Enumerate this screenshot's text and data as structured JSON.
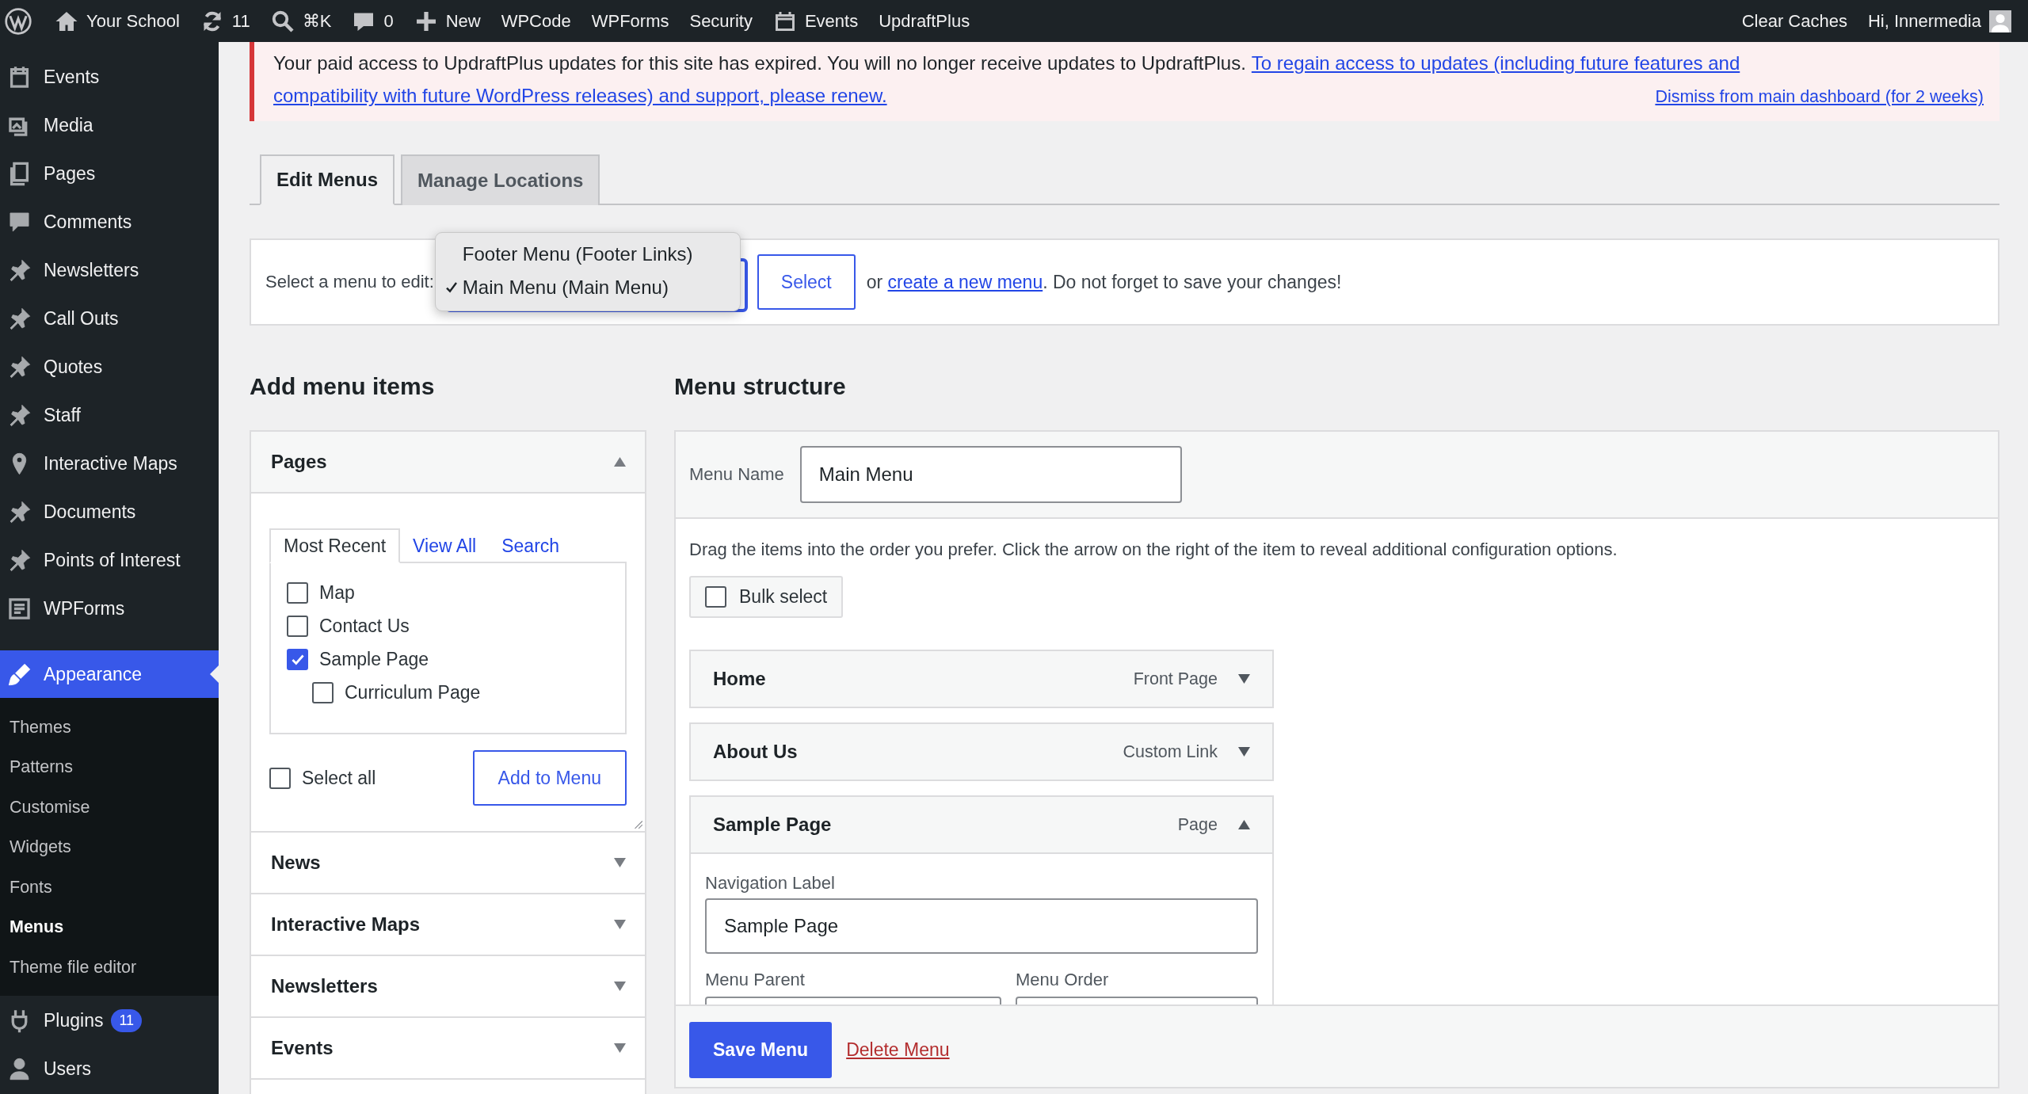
{
  "admin_bar": {
    "left": [
      {
        "kind": "wordpress"
      },
      {
        "kind": "home",
        "label": "Your School"
      },
      {
        "kind": "updates",
        "label": "11"
      },
      {
        "kind": "search",
        "label": "⌘K"
      },
      {
        "kind": "comments",
        "label": "0"
      },
      {
        "kind": "new",
        "label": "New"
      },
      {
        "kind": "text",
        "label": "WPCode"
      },
      {
        "kind": "text",
        "label": "WPForms"
      },
      {
        "kind": "text",
        "label": "Security"
      },
      {
        "kind": "calendar",
        "label": "Events"
      },
      {
        "kind": "text",
        "label": "UpdraftPlus"
      }
    ],
    "right": [
      {
        "kind": "text",
        "label": "Clear Caches"
      },
      {
        "kind": "account",
        "label": "Hi, Innermedia"
      }
    ]
  },
  "sidebar": {
    "items": [
      {
        "label": "Events",
        "kind": "calendar",
        "selected": false
      },
      {
        "label": "Media",
        "kind": "media",
        "selected": false
      },
      {
        "label": "Pages",
        "kind": "pages",
        "selected": false
      },
      {
        "label": "Comments",
        "kind": "comments",
        "selected": false
      },
      {
        "label": "Newsletters",
        "kind": "pin",
        "selected": false
      },
      {
        "label": "Call Outs",
        "kind": "pin",
        "selected": false
      },
      {
        "label": "Quotes",
        "kind": "pin",
        "selected": false
      },
      {
        "label": "Staff",
        "kind": "pin",
        "selected": false
      },
      {
        "label": "Interactive Maps",
        "kind": "location",
        "selected": false
      },
      {
        "label": "Documents",
        "kind": "pin",
        "selected": false
      },
      {
        "label": "Points of Interest",
        "kind": "pin",
        "selected": false
      },
      {
        "label": "WPForms",
        "kind": "forms",
        "selected": false
      },
      {
        "label": "Appearance",
        "kind": "brush",
        "selected": true,
        "children": [
          {
            "label": "Themes",
            "selected": false
          },
          {
            "label": "Patterns",
            "selected": false
          },
          {
            "label": "Customise",
            "selected": false
          },
          {
            "label": "Widgets",
            "selected": false
          },
          {
            "label": "Fonts",
            "selected": false
          },
          {
            "label": "Menus",
            "selected": true
          },
          {
            "label": "Theme file editor",
            "selected": false
          }
        ]
      },
      {
        "label": "Plugins",
        "kind": "plugin",
        "selected": false,
        "badge": "11"
      },
      {
        "label": "Users",
        "kind": "user",
        "selected": false
      }
    ]
  },
  "notice": {
    "message": "Your paid access to UpdraftPlus updates for this site has expired. You will no longer receive updates to UpdraftPlus.",
    "link_lines": [
      "To regain access to updates (including future features and",
      "compatibility with future WordPress releases) and support, please renew."
    ],
    "dismiss": "Dismiss from main dashboard (for 2 weeks)"
  },
  "tabs": [
    {
      "label": "Edit Menus",
      "selected": true
    },
    {
      "label": "Manage Locations",
      "selected": false
    }
  ],
  "menu_select": {
    "label": "Select a menu to edit:",
    "options": [
      {
        "label": "Footer Menu (Footer Links)",
        "selected": false
      },
      {
        "label": "Main Menu (Main Menu)",
        "selected": true
      }
    ],
    "button": "Select",
    "note_before": "or",
    "link": "create a new menu",
    "note_after": ". Do not forget to save your changes!"
  },
  "add_menu_items": {
    "heading": "Add menu items",
    "sections": [
      {
        "title": "Pages",
        "expanded": true,
        "tabs": [
          {
            "label": "Most Recent",
            "selected": true
          },
          {
            "label": "View All",
            "selected": false
          },
          {
            "label": "Search",
            "selected": false
          }
        ],
        "items": [
          {
            "label": "Map",
            "checked": false
          },
          {
            "label": "Contact Us",
            "checked": false
          },
          {
            "label": "Sample Page",
            "checked": true,
            "children": [
              {
                "label": "Curriculum Page",
                "checked": false
              }
            ]
          }
        ],
        "select_all": {
          "label": "Select all",
          "checked": false
        },
        "button": "Add to Menu"
      },
      {
        "title": "News",
        "expanded": false
      },
      {
        "title": "Interactive Maps",
        "expanded": false
      },
      {
        "title": "Newsletters",
        "expanded": false
      },
      {
        "title": "Events",
        "expanded": false
      }
    ]
  },
  "menu_structure": {
    "heading": "Menu structure",
    "menu_name": {
      "label": "Menu Name",
      "value": "Main Menu"
    },
    "instructions": "Drag the items into the order you prefer. Click the arrow on the right of the item to reveal additional configuration options.",
    "bulk_select": {
      "label": "Bulk select",
      "checked": false
    },
    "items": [
      {
        "title": "Home",
        "type": "Front Page",
        "expanded": false
      },
      {
        "title": "About Us",
        "type": "Custom Link",
        "expanded": false
      },
      {
        "title": "Sample Page",
        "type": "Page",
        "expanded": true,
        "navigation_label": {
          "label": "Navigation Label",
          "value": "Sample Page"
        },
        "menu_parent": "Menu Parent",
        "menu_order": "Menu Order"
      }
    ],
    "save_button": "Save Menu",
    "delete_link": "Delete Menu"
  }
}
